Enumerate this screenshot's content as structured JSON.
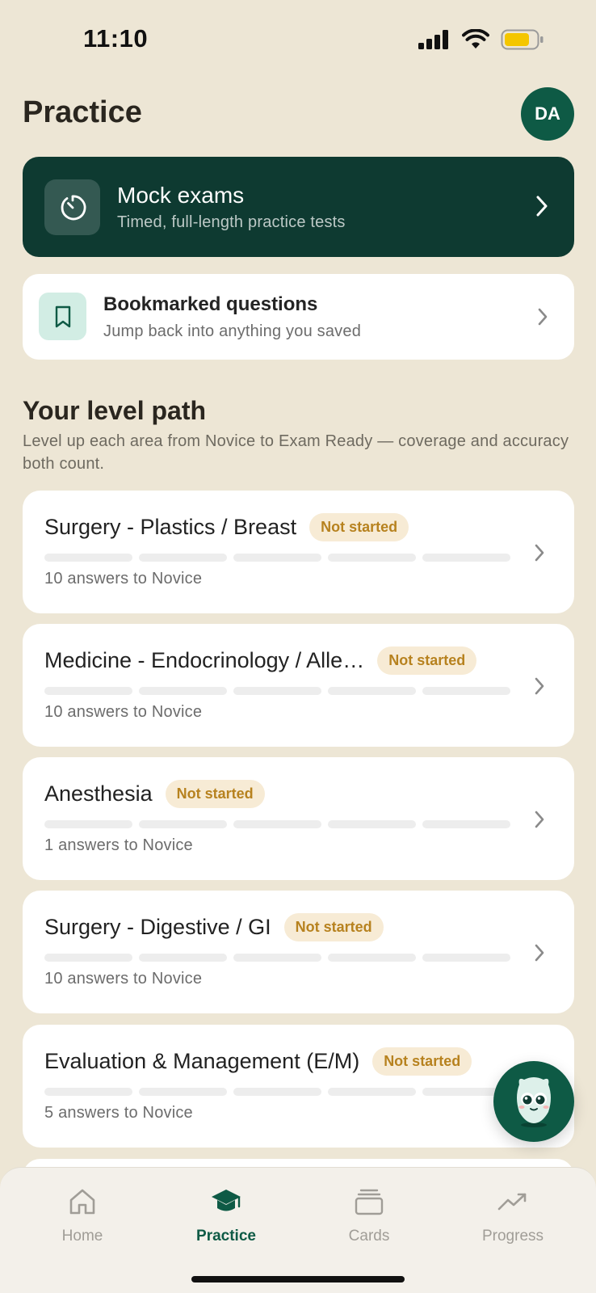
{
  "status_bar": {
    "time": "11:10"
  },
  "header": {
    "title": "Practice",
    "avatar_initials": "DA"
  },
  "mock_exams": {
    "title": "Mock exams",
    "subtitle": "Timed, full-length practice tests"
  },
  "bookmarked": {
    "title": "Bookmarked questions",
    "subtitle": "Jump back into anything you saved"
  },
  "level_path": {
    "title": "Your level path",
    "description": "Level up each area from Novice to Exam Ready — coverage and accuracy both count.",
    "items": [
      {
        "name": "Surgery - Plastics / Breast",
        "status": "Not started",
        "progress_segments_filled": 0,
        "subtitle": "10 answers to Novice"
      },
      {
        "name": "Medicine - Endocrinology / Alle…",
        "status": "Not started",
        "progress_segments_filled": 0,
        "subtitle": "10 answers to Novice"
      },
      {
        "name": "Anesthesia",
        "status": "Not started",
        "progress_segments_filled": 0,
        "subtitle": "1 answers to Novice"
      },
      {
        "name": "Surgery - Digestive / GI",
        "status": "Not started",
        "progress_segments_filled": 0,
        "subtitle": "10 answers to Novice"
      },
      {
        "name": "Evaluation & Management (E/M)",
        "status": "Not started",
        "progress_segments_filled": 0,
        "subtitle": "5 answers to Novice"
      }
    ]
  },
  "tab_bar": {
    "active": "Practice",
    "tabs": [
      {
        "label": "Home",
        "icon": "home-icon"
      },
      {
        "label": "Practice",
        "icon": "graduation-cap-icon"
      },
      {
        "label": "Cards",
        "icon": "cards-icon"
      },
      {
        "label": "Progress",
        "icon": "trend-up-icon"
      }
    ]
  },
  "colors": {
    "background": "#EDE6D5",
    "accent": "#0E5A45",
    "mock_card": "#0E3A31",
    "badge_text": "#B7821F",
    "badge_bg": "#F7EBD5"
  }
}
